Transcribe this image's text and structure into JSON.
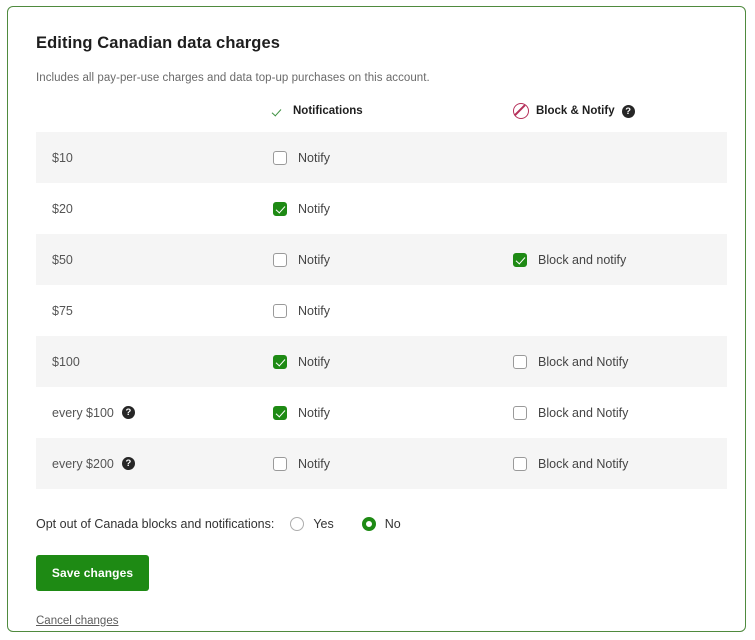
{
  "page": {
    "title": "Editing Canadian data charges",
    "subtitle": "Includes all pay-per-use charges and data top-up purchases on this account."
  },
  "table": {
    "headers": {
      "amount": "",
      "notifications": "Notifications",
      "block_notify": "Block & Notify",
      "block_notify_help_icon": "help-icon",
      "notifications_check_icon": "check-icon",
      "block_notify_block_icon": "block-circle-slash-icon"
    },
    "rows": [
      {
        "amount": "$10",
        "amount_help": false,
        "shaded": true,
        "notify": {
          "label": "Notify",
          "checked": false
        },
        "block": null
      },
      {
        "amount": "$20",
        "amount_help": false,
        "shaded": false,
        "notify": {
          "label": "Notify",
          "checked": true
        },
        "block": null
      },
      {
        "amount": "$50",
        "amount_help": false,
        "shaded": true,
        "notify": {
          "label": "Notify",
          "checked": false
        },
        "block": {
          "label": "Block and notify",
          "checked": true
        }
      },
      {
        "amount": "$75",
        "amount_help": false,
        "shaded": false,
        "notify": {
          "label": "Notify",
          "checked": false
        },
        "block": null
      },
      {
        "amount": "$100",
        "amount_help": false,
        "shaded": true,
        "notify": {
          "label": "Notify",
          "checked": true
        },
        "block": {
          "label": "Block and Notify",
          "checked": false
        }
      },
      {
        "amount": "every $100",
        "amount_help": true,
        "shaded": false,
        "notify": {
          "label": "Notify",
          "checked": true
        },
        "block": {
          "label": "Block and Notify",
          "checked": false
        }
      },
      {
        "amount": "every $200",
        "amount_help": true,
        "shaded": true,
        "notify": {
          "label": "Notify",
          "checked": false
        },
        "block": {
          "label": "Block and Notify",
          "checked": false
        }
      }
    ]
  },
  "optout": {
    "label": "Opt out of Canada blocks and notifications:",
    "options": [
      {
        "label": "Yes",
        "selected": false
      },
      {
        "label": "No",
        "selected": true
      }
    ]
  },
  "actions": {
    "save_label": "Save changes",
    "cancel_label": "Cancel changes"
  },
  "help_glyph": "?",
  "colors": {
    "accent_green": "#1e8a14",
    "card_border_green": "#4f8a3e",
    "block_red": "#b5305a",
    "row_shade": "#f5f5f5"
  }
}
